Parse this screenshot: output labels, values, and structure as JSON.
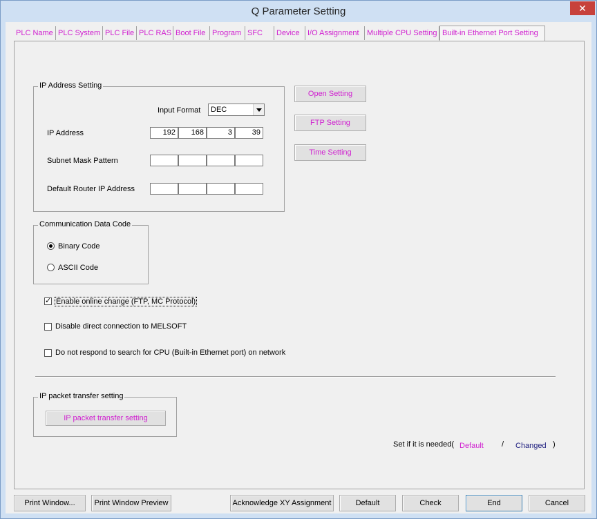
{
  "window": {
    "title": "Q Parameter Setting",
    "close_glyph": "✕"
  },
  "tabs": [
    {
      "label": "PLC Name"
    },
    {
      "label": "PLC System"
    },
    {
      "label": "PLC File"
    },
    {
      "label": "PLC RAS"
    },
    {
      "label": "Boot File"
    },
    {
      "label": "Program"
    },
    {
      "label": "SFC"
    },
    {
      "label": "Device"
    },
    {
      "label": "I/O Assignment"
    },
    {
      "label": "Multiple CPU Setting"
    },
    {
      "label": "Built-in Ethernet Port Setting"
    }
  ],
  "ip_setting": {
    "group_title": "IP Address Setting",
    "input_format_label": "Input Format",
    "input_format_value": "DEC",
    "ip_address_label": "IP Address",
    "ip_address": [
      "192",
      "168",
      "3",
      "39"
    ],
    "subnet_label": "Subnet Mask Pattern",
    "subnet": [
      "",
      "",
      "",
      ""
    ],
    "router_label": "Default Router IP Address",
    "router": [
      "",
      "",
      "",
      ""
    ]
  },
  "side_buttons": {
    "open": "Open Setting",
    "ftp": "FTP Setting",
    "time": "Time Setting"
  },
  "comm_code": {
    "group_title": "Communication Data Code",
    "binary": "Binary Code",
    "ascii": "ASCII Code",
    "selected": "binary"
  },
  "options": {
    "online_change": "Enable online change (FTP, MC Protocol)",
    "online_change_checked": true,
    "disable_direct": "Disable direct connection to MELSOFT",
    "disable_direct_checked": false,
    "no_respond": "Do not respond to search for CPU (Built-in Ethernet port) on network",
    "no_respond_checked": false
  },
  "ip_packet": {
    "group_title": "IP packet transfer setting",
    "button": "IP packet transfer setting"
  },
  "legend": {
    "prefix": "Set if it is needed(",
    "default": "Default",
    "slash": "/",
    "changed": "Changed",
    "suffix": ")",
    "default_color": "#d020d0",
    "changed_color": "#202080"
  },
  "footer": {
    "print_window": "Print Window...",
    "print_preview": "Print Window Preview",
    "acknowledge": "Acknowledge XY Assignment",
    "default": "Default",
    "check": "Check",
    "end": "End",
    "cancel": "Cancel"
  },
  "check_glyph": "✓"
}
